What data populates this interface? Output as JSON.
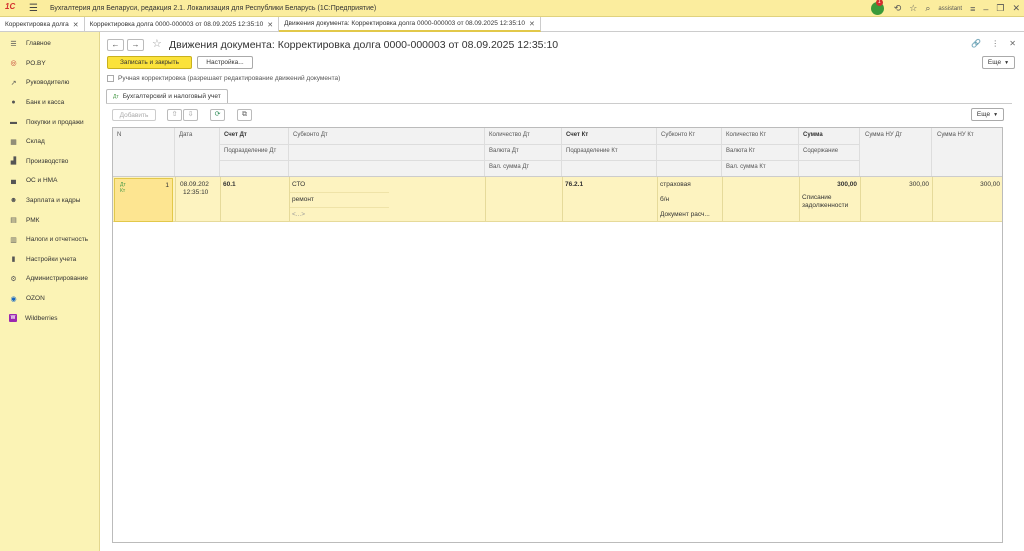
{
  "app": {
    "logo": "1С",
    "title": "Бухгалтерия для Беларуси, редакция 2.1. Локализация для Республики Беларусь   (1С:Предприятие)",
    "notif_count": "1",
    "user": "assistant"
  },
  "open_tabs": [
    {
      "label": "Корректировка долга"
    },
    {
      "label": "Корректировка долга 0000-000003 от 08.09.2025 12:35:10"
    },
    {
      "label": "Движения документа: Корректировка долга 0000-000003 от 08.09.2025 12:35:10"
    }
  ],
  "sidebar": {
    "items": [
      {
        "label": "Главное",
        "icon": "menu-icon"
      },
      {
        "label": "РО.BY",
        "icon": "pin-icon"
      },
      {
        "label": "Руководителю",
        "icon": "trend-icon"
      },
      {
        "label": "Банк и касса",
        "icon": "bank-icon"
      },
      {
        "label": "Покупки и продажи",
        "icon": "cart-icon"
      },
      {
        "label": "Склад",
        "icon": "warehouse-icon"
      },
      {
        "label": "Производство",
        "icon": "factory-icon"
      },
      {
        "label": "ОС и НМА",
        "icon": "car-icon"
      },
      {
        "label": "Зарплата и кадры",
        "icon": "people-icon"
      },
      {
        "label": "РМК",
        "icon": "register-icon"
      },
      {
        "label": "Налоги и отчетность",
        "icon": "report-icon"
      },
      {
        "label": "Настройки учета",
        "icon": "settings-doc-icon"
      },
      {
        "label": "Администрирование",
        "icon": "gear-icon"
      },
      {
        "label": "OZON",
        "icon": "ozon-icon"
      },
      {
        "label": "Wildberries",
        "icon": "wb-icon"
      }
    ]
  },
  "doc": {
    "title": "Движения документа: Корректировка долга 0000-000003 от 08.09.2025 12:35:10",
    "save_close": "Записать и закрыть",
    "settings": "Настройка...",
    "more": "Еще",
    "manual_label": "Ручная корректировка (разрешает редактирование движений документа)",
    "form_tab": "Бухгалтерский и налоговый учет",
    "add": "Добавить",
    "table_more": "Еще"
  },
  "table": {
    "headers": {
      "n": "N",
      "date": "Дата",
      "acc_dt": "Счет Дт",
      "div_dt": "Подразделение Дт",
      "sub_dt": "Субконто Дт",
      "qty_dt": "Количество Дт",
      "cur_dt": "Валюта Дт",
      "cur_sum_dt": "Вал. сумма Дт",
      "acc_kt": "Счет Кт",
      "div_kt": "Подразделение Кт",
      "sub_kt": "Субконто Кт",
      "qty_kt": "Количество Кт",
      "cur_kt": "Валюта Кт",
      "cur_sum_kt": "Вал. сумма Кт",
      "sum": "Сумма",
      "content": "Содержание",
      "sum_nu_dt": "Сумма НУ Дт",
      "sum_nu_kt": "Сумма НУ Кт"
    },
    "row": {
      "n": "1",
      "date1": "08.09.202",
      "date2": "12:35:10",
      "acc_dt": "60.1",
      "sub_dt1": "СТО",
      "sub_dt2": "ремонт",
      "sub_dt3": "<...>",
      "acc_kt": "76.2.1",
      "sub_kt1": "страховая",
      "sub_kt2": "б/н",
      "sub_kt3": "Документ расч...",
      "sum": "300,00",
      "content1": "Списание",
      "content2": "задолженности",
      "sum_nu_dt": "300,00",
      "sum_nu_kt": "300,00"
    }
  }
}
